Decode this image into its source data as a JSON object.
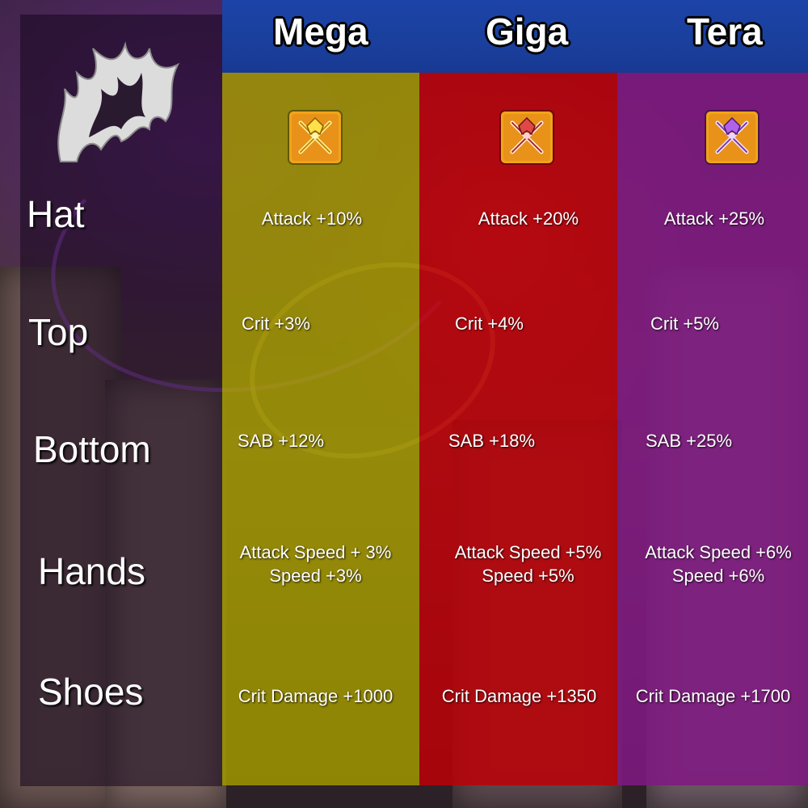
{
  "tiers": [
    {
      "name": "Mega",
      "color": "#a39600",
      "icon": "mega-axe-emblem-icon"
    },
    {
      "name": "Giga",
      "color": "#be0006",
      "icon": "giga-axe-emblem-icon"
    },
    {
      "name": "Tera",
      "color": "#801882",
      "icon": "tera-axe-emblem-icon"
    }
  ],
  "header_color": "#1a3f9c",
  "crest_icon": "flame-crest-icon",
  "rows": [
    {
      "label": "Hat",
      "stats": [
        "Attack +10%",
        "Attack +20%",
        "Attack +25%"
      ]
    },
    {
      "label": "Top",
      "stats": [
        "Crit +3%",
        "Crit +4%",
        "Crit +5%"
      ]
    },
    {
      "label": "Bottom",
      "stats": [
        "SAB +12%",
        "SAB +18%",
        "SAB +25%"
      ]
    },
    {
      "label": "Hands",
      "stats": [
        [
          "Attack Speed + 3%",
          "Speed +3%"
        ],
        [
          "Attack Speed +5%",
          "Speed +5%"
        ],
        [
          "Attack Speed +6%",
          "Speed +6%"
        ]
      ]
    },
    {
      "label": "Shoes",
      "stats": [
        "Crit Damage +1000",
        "Crit Damage +1350",
        "Crit Damage +1700"
      ]
    }
  ]
}
